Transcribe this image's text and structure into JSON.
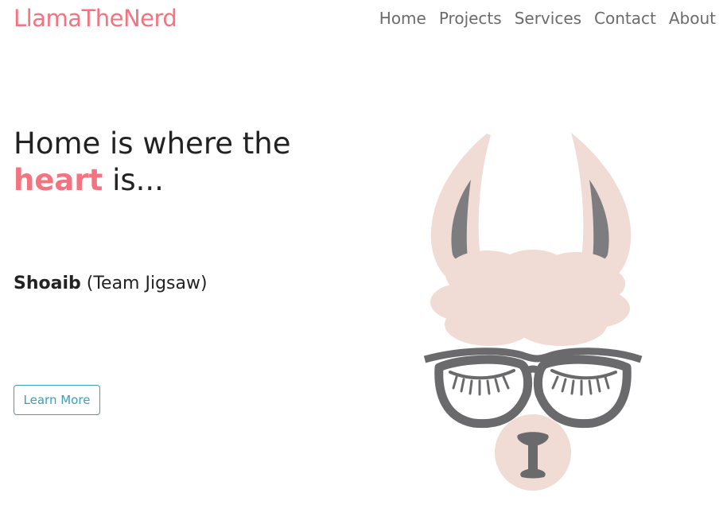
{
  "header": {
    "brand": "LlamaTheNerd",
    "nav": [
      {
        "label": "Home"
      },
      {
        "label": "Projects"
      },
      {
        "label": "Services"
      },
      {
        "label": "Contact"
      },
      {
        "label": "About"
      }
    ]
  },
  "hero": {
    "title_line1": "Home is where the",
    "title_accent": "heart",
    "title_rest": " is...",
    "author_name": "Shoaib",
    "author_team": " (Team Jigsaw)",
    "cta_label": "Learn More"
  },
  "colors": {
    "accent": "#f5737f",
    "button": "#3a9fb9",
    "llama_fur": "#f0dbd5",
    "llama_glasses": "#6a6a6c"
  }
}
